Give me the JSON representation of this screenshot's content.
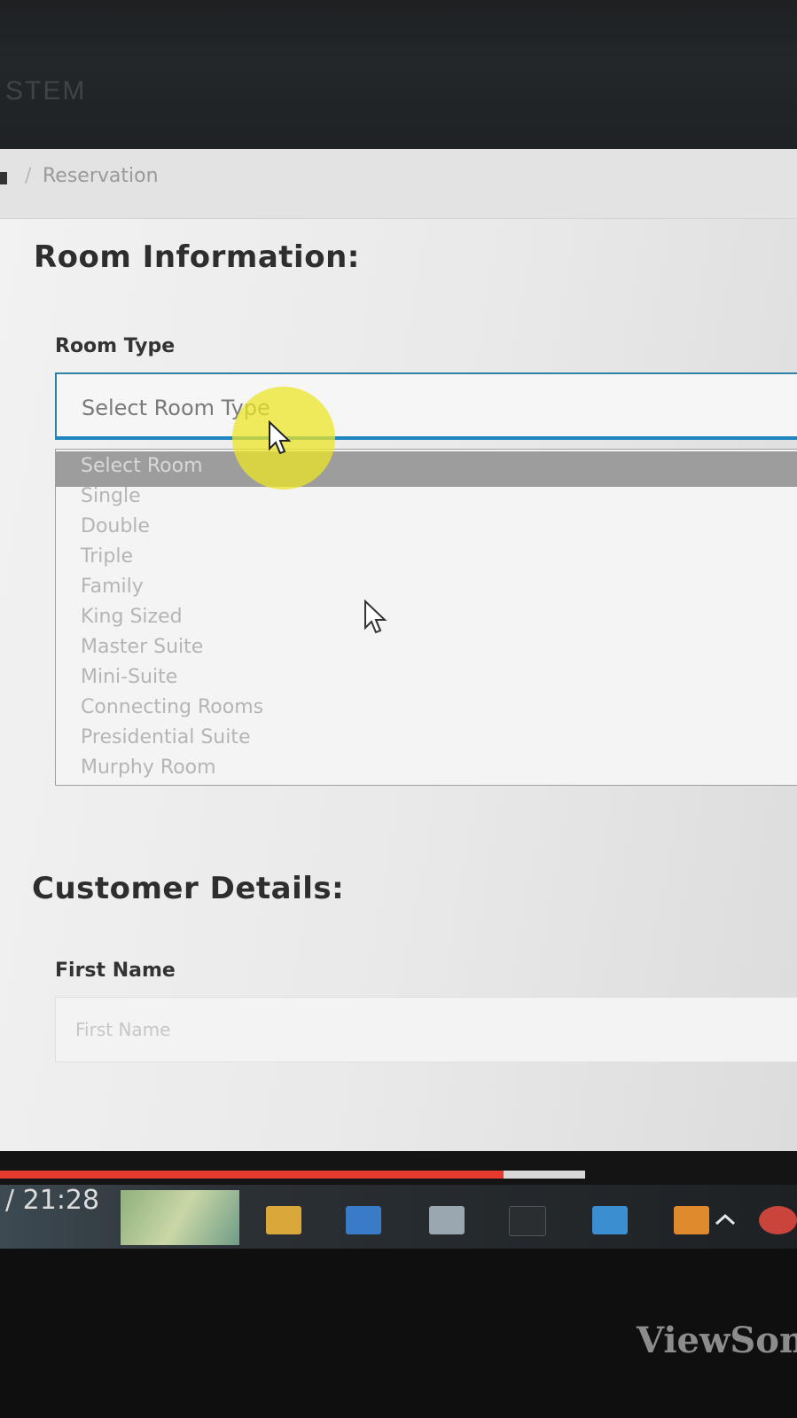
{
  "app": {
    "title_fragment": "STEM"
  },
  "breadcrumb": {
    "separator": "/",
    "current": "Reservation"
  },
  "room_section": {
    "title": "Room Information:",
    "room_type_label": "Room Type",
    "room_type_value": "Select Room Type",
    "options": [
      "Select Room",
      "Single",
      "Double",
      "Triple",
      "Family",
      "King Sized",
      "Master Suite",
      "Mini-Suite",
      "Connecting Rooms",
      "Presidential Suite",
      "Murphy Room"
    ],
    "selected_option_index": 0
  },
  "customer_section": {
    "title": "Customer Details:",
    "first_name_label": "First Name",
    "first_name_placeholder": "First Name"
  },
  "video_player": {
    "time_display": "/ 21:28",
    "progress_fraction": 0.86
  },
  "monitor": {
    "brand_fragment": "ViewSon"
  },
  "colors": {
    "select_border": "#2f7fa6",
    "progress": "#e63a2e",
    "cursor_highlight": "#ebe628"
  },
  "taskbar_icons": [
    "folder-icon",
    "store-icon",
    "cloud-icon",
    "terminal-icon",
    "monitor-icon",
    "app-icon",
    "chevron-up-icon",
    "chrome-icon"
  ]
}
